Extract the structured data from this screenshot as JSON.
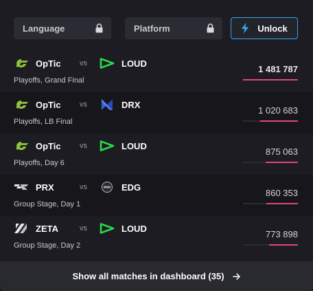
{
  "filters": {
    "language_label": "Language",
    "platform_label": "Platform",
    "unlock_label": "Unlock"
  },
  "matches": [
    {
      "team1": "OpTic",
      "team2": "LOUD",
      "vs": "vs",
      "stage": "Playoffs, Grand Final",
      "viewers": "1 481 787",
      "viewer_share": 1.0
    },
    {
      "team1": "OpTic",
      "team2": "DRX",
      "vs": "vs",
      "stage": "Playoffs, LB Final",
      "viewers": "1 020 683",
      "viewer_share": 0.69
    },
    {
      "team1": "OpTic",
      "team2": "LOUD",
      "vs": "vs",
      "stage": "Playoffs, Day 6",
      "viewers": "875 063",
      "viewer_share": 0.59
    },
    {
      "team1": "PRX",
      "team2": "EDG",
      "vs": "vs",
      "stage": "Group Stage, Day 1",
      "viewers": "860 353",
      "viewer_share": 0.58
    },
    {
      "team1": "ZETA",
      "team2": "LOUD",
      "vs": "vs",
      "stage": "Group Stage, Day 2",
      "viewers": "773 898",
      "viewer_share": 0.52
    }
  ],
  "footer": {
    "label": "Show all matches in dashboard (35)"
  },
  "colors": {
    "accent_bar": "#e0487a",
    "unlock_border": "#3aa5e8",
    "optic_green": "#92c83e",
    "loud_green": "#2bd94a",
    "drx_blue": "#3a5fe0"
  }
}
